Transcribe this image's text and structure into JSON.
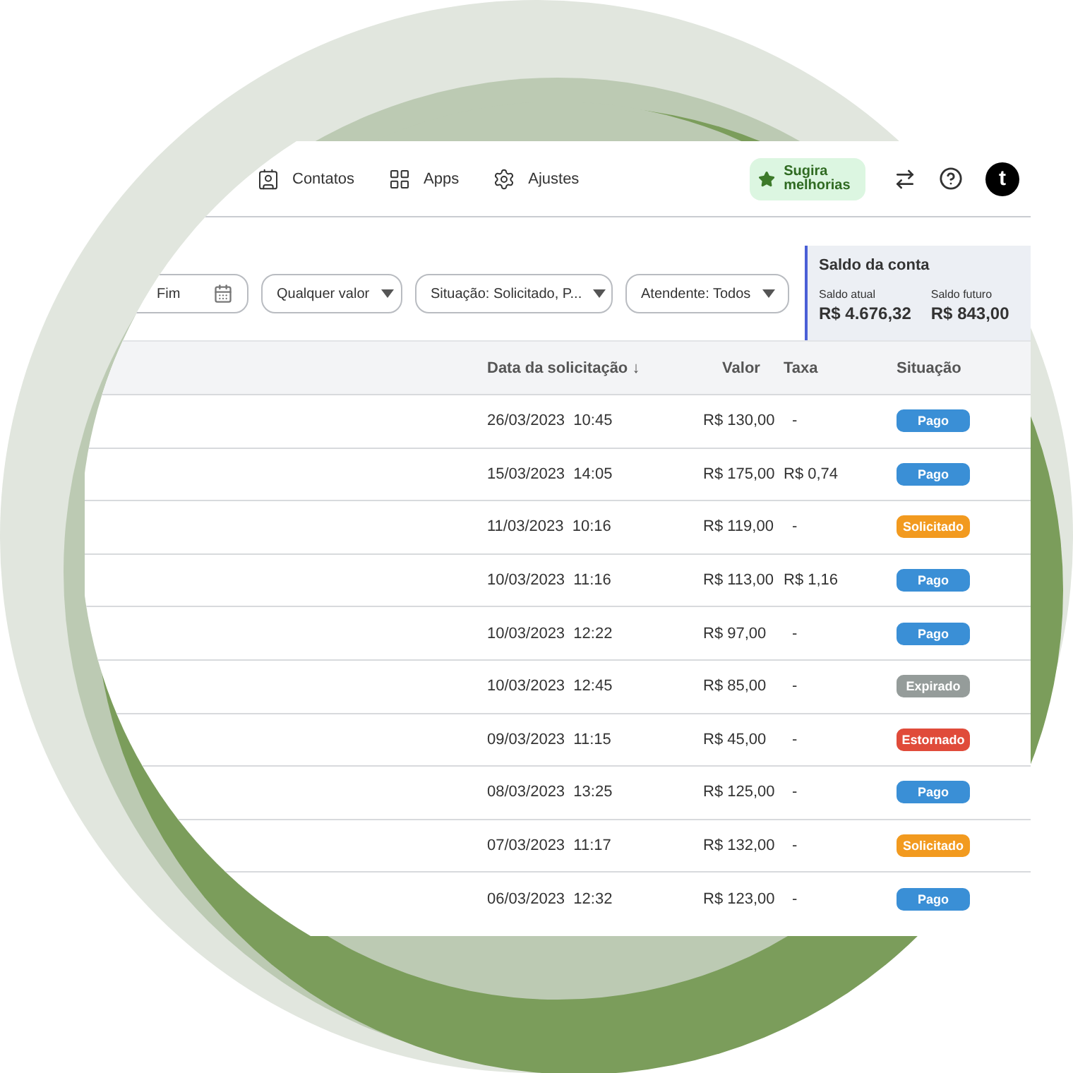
{
  "nav": {
    "items": [
      {
        "label": "Contatos"
      },
      {
        "label": "Apps"
      },
      {
        "label": "Ajustes"
      }
    ],
    "suggest_button": "Sugira melhorias",
    "avatar": "t"
  },
  "filters": [
    {
      "kind": "date",
      "label": "Fim"
    },
    {
      "kind": "select",
      "label": "Qualquer valor"
    },
    {
      "kind": "select",
      "label": "Situação: Solicitado, P..."
    },
    {
      "kind": "select",
      "label": "Atendente: Todos"
    }
  ],
  "balance": {
    "title": "Saldo da conta",
    "items": [
      {
        "label": "Saldo atual",
        "value": "R$ 4.676,32"
      },
      {
        "label": "Saldo futuro",
        "value": "R$ 843,00"
      }
    ]
  },
  "table": {
    "columns": [
      "Data da solicitação ↓",
      "Valor",
      "Taxa",
      "Situação"
    ],
    "rows": [
      {
        "date": "26/03/2023  10:45",
        "value": "R$ 130,00",
        "fee": "-",
        "status": "Pago",
        "color": "#3a8fd6"
      },
      {
        "date": "15/03/2023  14:05",
        "value": "R$ 175,00",
        "fee": "R$ 0,74",
        "status": "Pago",
        "color": "#3a8fd6"
      },
      {
        "date": "11/03/2023  10:16",
        "value": "R$ 119,00",
        "fee": "-",
        "status": "Solicitado",
        "color": "#f29a1f"
      },
      {
        "date": "10/03/2023  11:16",
        "value": "R$ 113,00",
        "fee": "R$ 1,16",
        "status": "Pago",
        "color": "#3a8fd6"
      },
      {
        "date": "10/03/2023  12:22",
        "value": "R$ 97,00",
        "fee": "-",
        "status": "Pago",
        "color": "#3a8fd6"
      },
      {
        "date": "10/03/2023  12:45",
        "value": "R$ 85,00",
        "fee": "-",
        "status": "Expirado",
        "color": "#959c9a"
      },
      {
        "date": "09/03/2023  11:15",
        "value": "R$ 45,00",
        "fee": "-",
        "status": "Estornado",
        "color": "#e04b3a"
      },
      {
        "date": "08/03/2023  13:25",
        "value": "R$ 125,00",
        "fee": "-",
        "status": "Pago",
        "color": "#3a8fd6"
      },
      {
        "date": "07/03/2023  11:17",
        "value": "R$ 132,00",
        "fee": "-",
        "status": "Solicitado",
        "color": "#f29a1f"
      },
      {
        "date": "06/03/2023  12:32",
        "value": "R$ 123,00",
        "fee": "-",
        "status": "Pago",
        "color": "#3a8fd6"
      }
    ]
  }
}
